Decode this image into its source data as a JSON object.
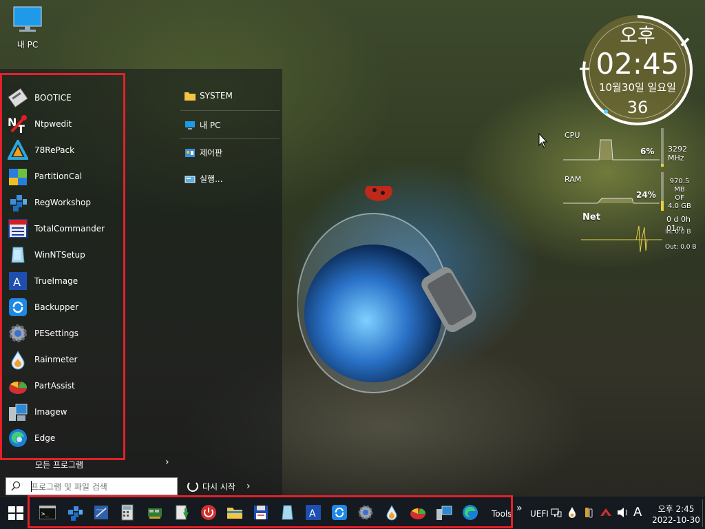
{
  "desktop": {
    "my_pc_label": "내 PC"
  },
  "start_menu": {
    "apps": [
      {
        "label": "BOOTICE",
        "icon": "bootice-icon"
      },
      {
        "label": "Ntpwedit",
        "icon": "ntpwedit-icon"
      },
      {
        "label": "78RePack",
        "icon": "78repack-icon"
      },
      {
        "label": "PartitionCal",
        "icon": "partitioncal-icon"
      },
      {
        "label": "RegWorkshop",
        "icon": "regworkshop-icon"
      },
      {
        "label": "TotalCommander",
        "icon": "totalcommander-icon"
      },
      {
        "label": "WinNTSetup",
        "icon": "winntsetup-icon"
      },
      {
        "label": "TrueImage",
        "icon": "trueimage-icon"
      },
      {
        "label": "Backupper",
        "icon": "backupper-icon"
      },
      {
        "label": "PESettings",
        "icon": "gear-icon"
      },
      {
        "label": "Rainmeter",
        "icon": "rainmeter-icon"
      },
      {
        "label": "PartAssist",
        "icon": "partassist-icon"
      },
      {
        "label": "Imagew",
        "icon": "imagew-icon"
      },
      {
        "label": "Edge",
        "icon": "edge-icon"
      }
    ],
    "all_programs_label": "모든 프로그램",
    "search_placeholder": "프로그램 및 파일 검색",
    "restart_label": "다시 시작",
    "right_items": [
      {
        "label": "SYSTEM",
        "icon": "folder-icon"
      },
      {
        "label": "내 PC",
        "icon": "computer-icon"
      },
      {
        "label": "제어판",
        "icon": "control-panel-icon"
      },
      {
        "label": "실행...",
        "icon": "run-icon"
      }
    ]
  },
  "clock_gadget": {
    "ampm": "오후",
    "time": "02:45",
    "date": "10월30일 일요일",
    "seconds": "36"
  },
  "system_monitor": {
    "cpu_label": "CPU",
    "cpu_percent": "6%",
    "cpu_freq": "3292 MHz",
    "ram_label": "RAM",
    "ram_percent": "24%",
    "ram_used": "970.5 MB",
    "ram_of": "OF",
    "ram_total": "4.0 GB",
    "net_label": "Net",
    "uptime": "0 d 0h 01m",
    "net_in": "In: 0.0 B",
    "net_out": "Out: 0.0 B"
  },
  "taskbar": {
    "pinned": [
      "cmd-icon",
      "regworkshop-icon",
      "notepad-icon",
      "calculator-icon",
      "network-card-icon",
      "installer-icon",
      "power-icon",
      "explorer-icon",
      "save-icon",
      "winntsetup-icon",
      "trueimage-icon",
      "backupper-icon",
      "gear-icon",
      "rainmeter-icon",
      "partassist-icon",
      "imagew-icon",
      "edge-icon"
    ],
    "tools_label": "Tools",
    "overflow_label": "»",
    "uefi_label": "UEFI",
    "ime_label": "A",
    "clock_time": "오후 2:45",
    "clock_date": "2022-10-30"
  },
  "colors": {
    "highlight_frame": "#e3212b",
    "taskbar_bg": "#141a1f"
  }
}
